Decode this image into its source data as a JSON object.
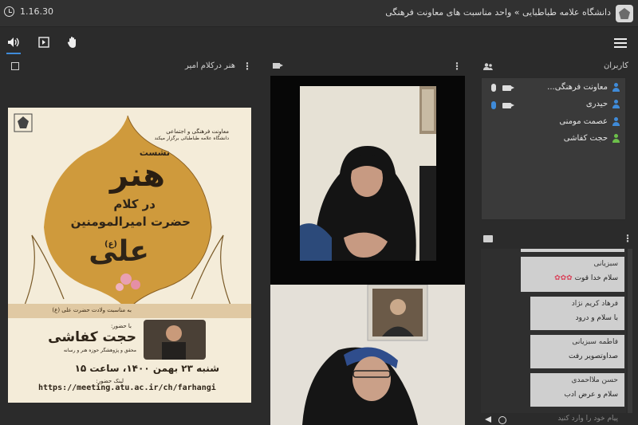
{
  "topbar": {
    "timer": "1.16.30",
    "title": "دانشگاه علامه طباطبایی » واحد مناسبت های معاونت فرهنگی"
  },
  "presentation": {
    "title": "هنر درکلام امیر",
    "poster": {
      "org_line1": "معاونت فرهنگی و اجتماعی",
      "org_line2": "دانشگاه علامه طباطبائی برگزار میکند",
      "word1": "نشست",
      "word2": "هنر",
      "word3": "در کلام",
      "word4": "حضرت امیرالمومنین",
      "word5": "علی",
      "word6": "(ع)",
      "occasion": "به مناسبت ولادت حضرت علی (ع)",
      "with": "با حضور:",
      "speaker": "حجت کفاشی",
      "speaker_role": "محقق و پژوهشگر حوزه هنر و رسانه",
      "date": "شنبه ۲۳ بهمن ۱۴۰۰، ساعت ۱۵",
      "link_label": "لینک حضور:",
      "link": "https://meeting.atu.ac.ir/ch/farhangi"
    }
  },
  "users": {
    "title": "کاربران",
    "list": [
      {
        "name": "معاونت فرهنگی...",
        "color": "#3f8bd9"
      },
      {
        "name": "حیدری",
        "color": "#3f8bd9"
      },
      {
        "name": "عصمت مومنی",
        "color": "#3f8bd9"
      },
      {
        "name": "حجت کفاشی",
        "color": "#6cc04a"
      }
    ]
  },
  "chat": {
    "messages": [
      {
        "name": "سبزیانی",
        "text": "سلام خدا قوت"
      },
      {
        "name": "فرهاد کریم نژاد",
        "text": "با سلام و درود"
      },
      {
        "name": "فاطمه سبزیانی",
        "text": "صداوتصویر رفت"
      },
      {
        "name": "حسن ملااحمدی",
        "text": "سلام و عرض ادب"
      }
    ],
    "placeholder": "پیام خود را وارد کنید"
  }
}
